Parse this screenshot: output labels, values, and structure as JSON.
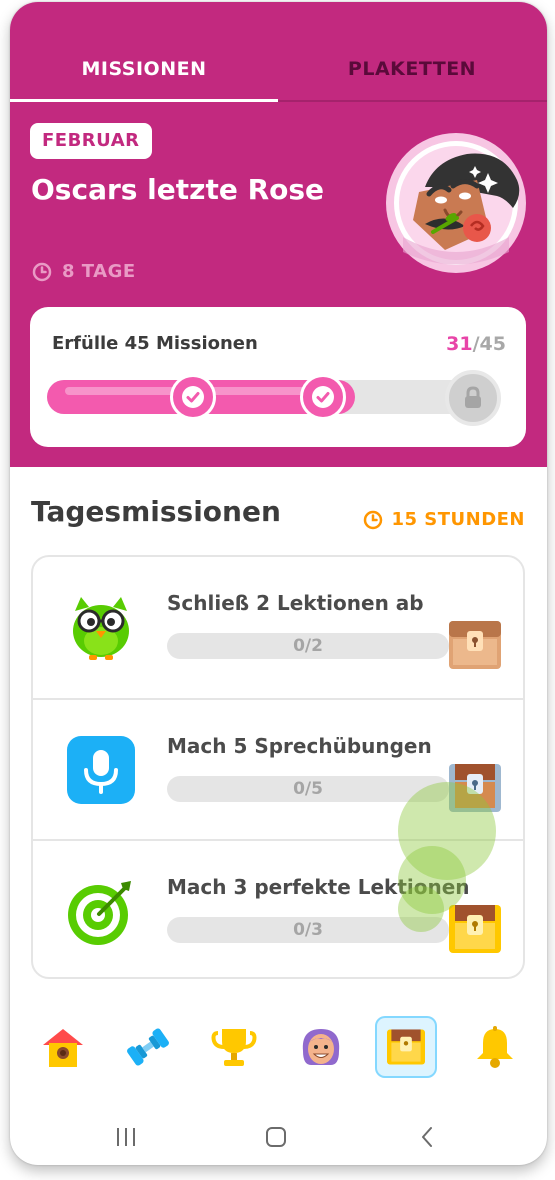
{
  "tabs": [
    {
      "label": "MISSIONEN",
      "active": true
    },
    {
      "label": "PLAKETTEN",
      "active": false
    }
  ],
  "event": {
    "month": "FEBRUAR",
    "title": "Oscars letzte Rose",
    "time_left": "8 TAGE",
    "avatar_icon": "oscar-with-rose-avatar"
  },
  "monthly_goal": {
    "label": "Erfülle 45 Missionen",
    "current": "31",
    "separator": "/",
    "total": "45",
    "progress": 0.69,
    "milestones_completed": 2
  },
  "daily": {
    "title": "Tagesmissionen",
    "time_left": "15 STUNDEN",
    "quests": [
      {
        "text": "Schließ 2 Lektionen ab",
        "progress": "0/2",
        "icon": "owl-icon",
        "reward": "bronze-chest-icon"
      },
      {
        "text": "Mach 5 Sprechübungen",
        "progress": "0/5",
        "icon": "microphone-icon",
        "reward": "silver-chest-icon"
      },
      {
        "text": "Mach 3 perfekte Lektionen",
        "progress": "0/3",
        "icon": "target-icon",
        "reward": "gold-chest-icon"
      }
    ]
  },
  "bottom_nav": [
    {
      "name": "home-icon",
      "active": false
    },
    {
      "name": "practice-dumbbell-icon",
      "active": false
    },
    {
      "name": "leaderboard-trophy-icon",
      "active": false
    },
    {
      "name": "profile-avatar-icon",
      "active": false
    },
    {
      "name": "quests-chest-icon",
      "active": true
    },
    {
      "name": "notifications-bell-icon",
      "active": false
    }
  ],
  "colors": {
    "hero": "#c2297f",
    "accent_pink": "#f35aae",
    "timer_orange": "#ff9600",
    "text_dark": "#3c3c3c"
  }
}
